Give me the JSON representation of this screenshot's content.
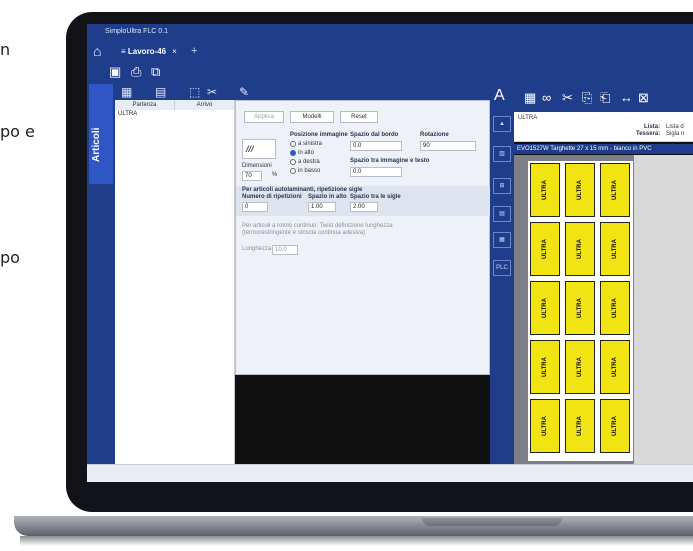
{
  "page_fragments": [
    "n",
    "po e",
    "po"
  ],
  "app": {
    "title": "SimploUltra  FLC 0.1",
    "tab": {
      "label": "Lavoro-46",
      "close": "×",
      "add": "+"
    }
  },
  "sidebar": {
    "label": "Articoli"
  },
  "table": {
    "columns": [
      "Partenza",
      "Arrivo"
    ],
    "rows": [
      [
        "ULTRA",
        ""
      ]
    ]
  },
  "panel": {
    "buttons": {
      "apply": "Applica",
      "models": "Modelli",
      "reset": "Reset"
    },
    "position_label": "Posizione immagine",
    "positions": [
      "a sinistra",
      "in alto",
      "a destra",
      "in basso"
    ],
    "selected_position": "in alto",
    "image_symbol": "///",
    "dimensions_label": "Dimensioni",
    "dimensions_value": "70",
    "dimensions_unit": "%",
    "border_label": "Spazio dal bordo",
    "border_value": "0.0",
    "rotation_label": "Rotazione",
    "rotation_value": "90",
    "img_text_label": "Spazio tra immagine e testo",
    "img_text_value": "0.0",
    "self_lam_label": "Per articoli autolaminanti, ripetizione sigle",
    "rep_label": "Numero di ripetizioni",
    "rep_value": "0",
    "top_space_label": "Spazio in alto",
    "top_space_value": "1.00",
    "sig_space_label": "Spazio tra le sigle",
    "sig_space_value": "2.00",
    "roll_label": "Per articoli a rotolo continuo: Twist definizione lunghezza",
    "roll_label2": "(termorestringente e striscia continua adesiva)",
    "length_label": "Lunghezza",
    "length_value": "10.0"
  },
  "right_panel": {
    "value": "ULTRA",
    "list_label": "Lista:",
    "list_value": "Lista d",
    "card_label": "Tessera:",
    "card_value": "Sigla n",
    "sheet_title": "EVO1527W Targhette 27 x 15 mm - bianco in PVC",
    "plc": "PLC",
    "cell_text": "ULTRA",
    "layout_letter": "A"
  }
}
